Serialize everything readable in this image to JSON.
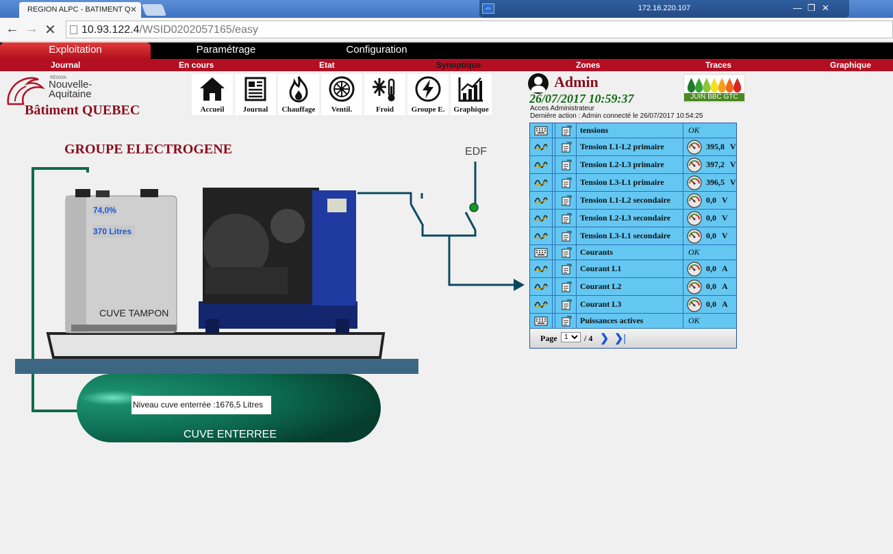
{
  "browser": {
    "tab_title": "REGION ALPC - BATIMENT Q",
    "remote_host": "172.16.220.107",
    "url_host": "10.93.122.4",
    "url_path": "/WSID0202057165/easy"
  },
  "menu_main": [
    "Exploitation",
    "Paramétrage",
    "Configuration"
  ],
  "menu_sub": [
    "Journal",
    "En cours",
    "Etat",
    "Synoptique",
    "Zones",
    "Traces",
    "Graphique"
  ],
  "logo": {
    "region_small": "RÉGION",
    "line1": "Nouvelle-",
    "line2": "Aquitaine",
    "building": "Bâtiment QUEBEC"
  },
  "toolbar": [
    "Accueil",
    "Journal",
    "Chauffage",
    "Ventil.",
    "Froid",
    "Groupe E.",
    "Graphique"
  ],
  "user": {
    "name": "Admin",
    "datetime": "26/07/2017 10:59:37",
    "access": "Acces Administrateur",
    "last_action": "Dernière action : Admin connecté le 26/07/2017 10:54:25"
  },
  "badge": "JUIN BBC GTC",
  "synoptic": {
    "title": "GROUPE ELECTROGENE",
    "edf": "EDF",
    "tank_percent": "74,0%",
    "tank_volume": "370 Litres",
    "tank_label": "CUVE TAMPON",
    "buried_level": "Niveau cuve enterrée :1676,5 Litres",
    "buried_label": "CUVE ENTERREE",
    "tank_fill_fraction": 0.74
  },
  "measurements": [
    {
      "label": "tensions",
      "type": "group",
      "status": "OK"
    },
    {
      "label": "Tension L1-L2 primaire",
      "type": "value",
      "value": "395,8",
      "unit": "V"
    },
    {
      "label": "Tension L2-L3 primaire",
      "type": "value",
      "value": "397,2",
      "unit": "V"
    },
    {
      "label": "Tension L3-L1 primaire",
      "type": "value",
      "value": "396,5",
      "unit": "V"
    },
    {
      "label": "Tension L1-L2 secondaire",
      "type": "value",
      "value": "0,0",
      "unit": "V"
    },
    {
      "label": "Tension L2-L3 secondaire",
      "type": "value",
      "value": "0,0",
      "unit": "V"
    },
    {
      "label": "Tension L3-L1 secondaire",
      "type": "value",
      "value": "0,0",
      "unit": "V"
    },
    {
      "label": "Courants",
      "type": "group",
      "status": "OK"
    },
    {
      "label": "Courant L1",
      "type": "value",
      "value": "0,0",
      "unit": "A"
    },
    {
      "label": "Courant L2",
      "type": "value",
      "value": "0,0",
      "unit": "A"
    },
    {
      "label": "Courant L3",
      "type": "value",
      "value": "0,0",
      "unit": "A"
    },
    {
      "label": "Puissances actives",
      "type": "group",
      "status": "OK"
    }
  ],
  "pager": {
    "label": "Page",
    "current": "1",
    "total": "/ 4"
  },
  "colors": {
    "brand_red": "#b20f23",
    "table_bg": "#63c7f2",
    "pipe": "#0a4a5e",
    "tank_green": "#0f7a5a"
  }
}
